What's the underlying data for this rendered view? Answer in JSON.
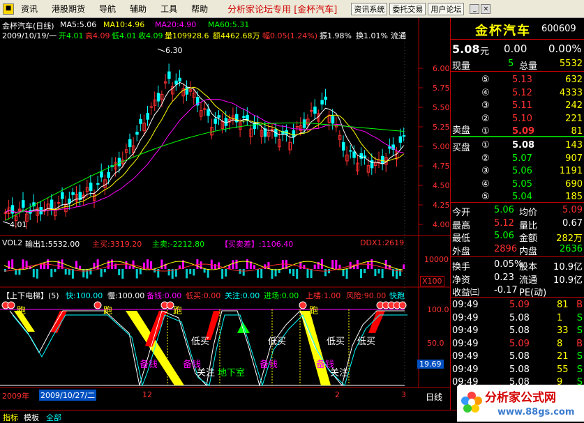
{
  "menu": {
    "items": [
      "资讯",
      "港股期货",
      "导航",
      "辅助",
      "工具",
      "帮助"
    ],
    "promo": "分析家论坛专用 [金杯汽车]",
    "toolbar": [
      "资讯系统",
      "委托交易",
      "用户论坛"
    ]
  },
  "main_chart": {
    "title": "金杯汽车(日线)",
    "ma5": "MA5:5.06",
    "ma10": "MA10:4.96",
    "ma20": "MA20:4.90",
    "ma60": "MA60:5.31",
    "info_date": "2009/10/19/一",
    "info_open": "开4.01",
    "info_high": "高4.09",
    "info_low": "低4.01",
    "info_close": "收4.09",
    "info_vol": "量109928.6",
    "info_amt": "额4462.68万",
    "info_chg": "幅0.05(1.24%)",
    "info_amp": "振1.98%",
    "info_turn": "换1.01%",
    "info_float": "流通",
    "high_mark": "6.30",
    "low_mark": "4.01",
    "y_ticks": [
      "6.00",
      "5.75",
      "5.50",
      "5.25",
      "5.00",
      "4.75",
      "4.50",
      "4.25",
      "4.00"
    ]
  },
  "vol_panel": {
    "title": "VOL2",
    "out": "输出1:5532.00",
    "buy": "主买:3319.20",
    "sell": "主卖:-2212.80",
    "diff": "【买卖差】:1106.40",
    "ddx": "DDX1:2619",
    "y_top": "10000",
    "y_unit": "X100"
  },
  "ladder_panel": {
    "title": "【上下电梯】(5)",
    "fast": "快:100.00",
    "slow": "慢:100.00",
    "bei": "备钱:0.00",
    "dibuy": "低买:0.00",
    "focus": "关注:0.00",
    "enter": "进场:0.00",
    "up": "上楼:1.00",
    "risk": "风险:90.00",
    "kuaipao": "快跑",
    "y_100": "100.0",
    "y_50": "50.0",
    "y_cursor": "19.69",
    "labels": {
      "pao": "跑",
      "dimai": "低买",
      "beiqian": "备钱",
      "guanzhu": "关注",
      "dixiashi": "地下室"
    }
  },
  "date_axis": {
    "cursor": "2009/10/27/二",
    "year": "2009年",
    "ticks": [
      "12",
      "2",
      "3"
    ]
  },
  "quote": {
    "name": "金杯汽车",
    "code": "600609",
    "price": "5.08",
    "unit": "元",
    "chg": "0.00",
    "pct": "0.00%",
    "now_label": "现量",
    "now_val": "5",
    "total_label": "总量",
    "total_val": "5532",
    "asks": [
      {
        "lvl": "⑤",
        "price": "5.13",
        "vol": "632"
      },
      {
        "lvl": "④",
        "price": "5.12",
        "vol": "4333"
      },
      {
        "lvl": "③",
        "price": "5.11",
        "vol": "242"
      },
      {
        "lvl": "②",
        "price": "5.10",
        "vol": "221"
      },
      {
        "lvl": "①",
        "price": "5.09",
        "vol": "81"
      }
    ],
    "ask_label": "卖盘",
    "bid_label": "买盘",
    "bids": [
      {
        "lvl": "①",
        "price": "5.08",
        "vol": "143"
      },
      {
        "lvl": "②",
        "price": "5.07",
        "vol": "907"
      },
      {
        "lvl": "③",
        "price": "5.06",
        "vol": "1191"
      },
      {
        "lvl": "④",
        "price": "5.05",
        "vol": "690"
      },
      {
        "lvl": "⑤",
        "price": "5.04",
        "vol": "185"
      }
    ],
    "stats": [
      {
        "l1": "今开",
        "v1": "5.06",
        "c1": "#00ff00",
        "l2": "均价",
        "v2": "5.09",
        "c2": "#ff3030"
      },
      {
        "l1": "最高",
        "v1": "5.12",
        "c1": "#ff3030",
        "l2": "量比",
        "v2": "0.67",
        "c2": "#ffffff"
      },
      {
        "l1": "最低",
        "v1": "5.06",
        "c1": "#00ff00",
        "l2": "金额",
        "v2": "282万",
        "c2": "#ffff00"
      },
      {
        "l1": "外盘",
        "v1": "2896",
        "c1": "#ff3030",
        "l2": "内盘",
        "v2": "2636",
        "c2": "#00ff00"
      }
    ],
    "fund": [
      {
        "l1": "换手",
        "v1": "0.05%",
        "l2": "股本",
        "v2": "10.9亿"
      },
      {
        "l1": "净资",
        "v1": "0.23",
        "l2": "流通",
        "v2": "10.9亿"
      },
      {
        "l1": "收益㈢",
        "v1": "-0.17",
        "l2": "PE(动)",
        "v2": ""
      }
    ],
    "ticks": [
      {
        "t": "09:49",
        "p": "5.09",
        "v": "81",
        "d": "B"
      },
      {
        "t": "09:49",
        "p": "5.08",
        "v": "1",
        "d": "S"
      },
      {
        "t": "09:49",
        "p": "5.08",
        "v": "33",
        "d": "S"
      },
      {
        "t": "09:49",
        "p": "5.09",
        "v": "8",
        "d": "B"
      },
      {
        "t": "09:49",
        "p": "5.08",
        "v": "21",
        "d": "S"
      },
      {
        "t": "09:49",
        "p": "5.08",
        "v": "55",
        "d": "S"
      },
      {
        "t": "09:49",
        "p": "5.08",
        "v": "9",
        "d": "S"
      }
    ]
  },
  "bottom": {
    "tabs": [
      "指标",
      "模板",
      "全部"
    ],
    "right": "日线"
  },
  "logo": {
    "title": "分析家公式网",
    "url": "www.88gs.com"
  },
  "colors": {
    "up": "#ff3030",
    "down": "#00ffff",
    "ma5": "#ffffff",
    "ma10": "#ffff00",
    "ma20": "#ff00ff",
    "ma60": "#00ff00",
    "grid": "#b00000"
  }
}
